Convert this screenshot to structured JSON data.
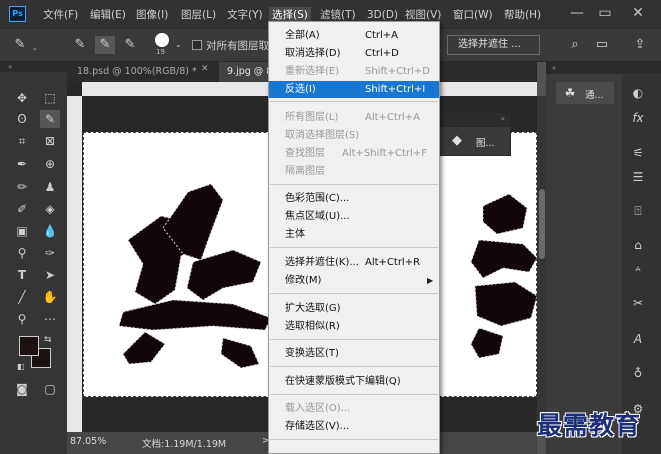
{
  "app": {
    "logo": "Ps"
  },
  "menubar": {
    "items": [
      {
        "label": "文件(F)"
      },
      {
        "label": "编辑(E)"
      },
      {
        "label": "图像(I)"
      },
      {
        "label": "图层(L)"
      },
      {
        "label": "文字(Y)"
      },
      {
        "label": "选择(S)"
      },
      {
        "label": "滤镜(T)"
      },
      {
        "label": "3D(D)"
      },
      {
        "label": "视图(V)"
      },
      {
        "label": "窗口(W)"
      },
      {
        "label": "帮助(H)"
      }
    ],
    "window_controls": {
      "minimize": "—",
      "restore": "▭",
      "close": "✕"
    }
  },
  "options_bar": {
    "brush_size": "19",
    "sample_all_layers_label": "对所有图层取",
    "select_and_mask_label": "选择并遮住 ..."
  },
  "tabs": [
    {
      "label": "18.psd @ 100%(RGB/8) *"
    },
    {
      "label": "9.jpg @ 8"
    }
  ],
  "select_menu": {
    "items": [
      {
        "label": "全部(A)",
        "shortcut": "Ctrl+A",
        "disabled": false
      },
      {
        "label": "取消选择(D)",
        "shortcut": "Ctrl+D",
        "disabled": false
      },
      {
        "label": "重新选择(E)",
        "shortcut": "Shift+Ctrl+D",
        "disabled": true
      },
      {
        "label": "反选(I)",
        "shortcut": "Shift+Ctrl+I",
        "disabled": false,
        "highlighted": true
      },
      {
        "label": "所有图层(L)",
        "shortcut": "Alt+Ctrl+A",
        "disabled": true
      },
      {
        "label": "取消选择图层(S)",
        "shortcut": "",
        "disabled": true
      },
      {
        "label": "查找图层",
        "shortcut": "Alt+Shift+Ctrl+F",
        "disabled": true
      },
      {
        "label": "隔离图层",
        "shortcut": "",
        "disabled": true
      },
      {
        "label": "色彩范围(C)...",
        "shortcut": "",
        "disabled": false
      },
      {
        "label": "焦点区域(U)...",
        "shortcut": "",
        "disabled": false
      },
      {
        "label": "主体",
        "shortcut": "",
        "disabled": false
      },
      {
        "label": "选择并遮住(K)...",
        "shortcut": "Alt+Ctrl+R",
        "disabled": false
      },
      {
        "label": "修改(M)",
        "shortcut": "",
        "disabled": false,
        "submenu": "▶"
      },
      {
        "label": "扩大选取(G)",
        "shortcut": "",
        "disabled": false
      },
      {
        "label": "选取相似(R)",
        "shortcut": "",
        "disabled": false
      },
      {
        "label": "变换选区(T)",
        "shortcut": "",
        "disabled": false
      },
      {
        "label": "在快速蒙版模式下编辑(Q)",
        "shortcut": "",
        "disabled": false
      },
      {
        "label": "载入选区(O)...",
        "shortcut": "",
        "disabled": true
      },
      {
        "label": "存储选区(V)...",
        "shortcut": "",
        "disabled": false
      }
    ]
  },
  "panels": {
    "channels_label": "通...",
    "layers_label": "图..."
  },
  "status": {
    "zoom": "87.05%",
    "doc_size": "文档:1.19M/1.19M",
    "arrow": ">"
  },
  "watermark": "最需教育",
  "colors": {
    "highlight": "#1b76d1",
    "menubar_bg": "#323232",
    "watermark": "#1d2f7a",
    "foreground": "#1c1210"
  }
}
